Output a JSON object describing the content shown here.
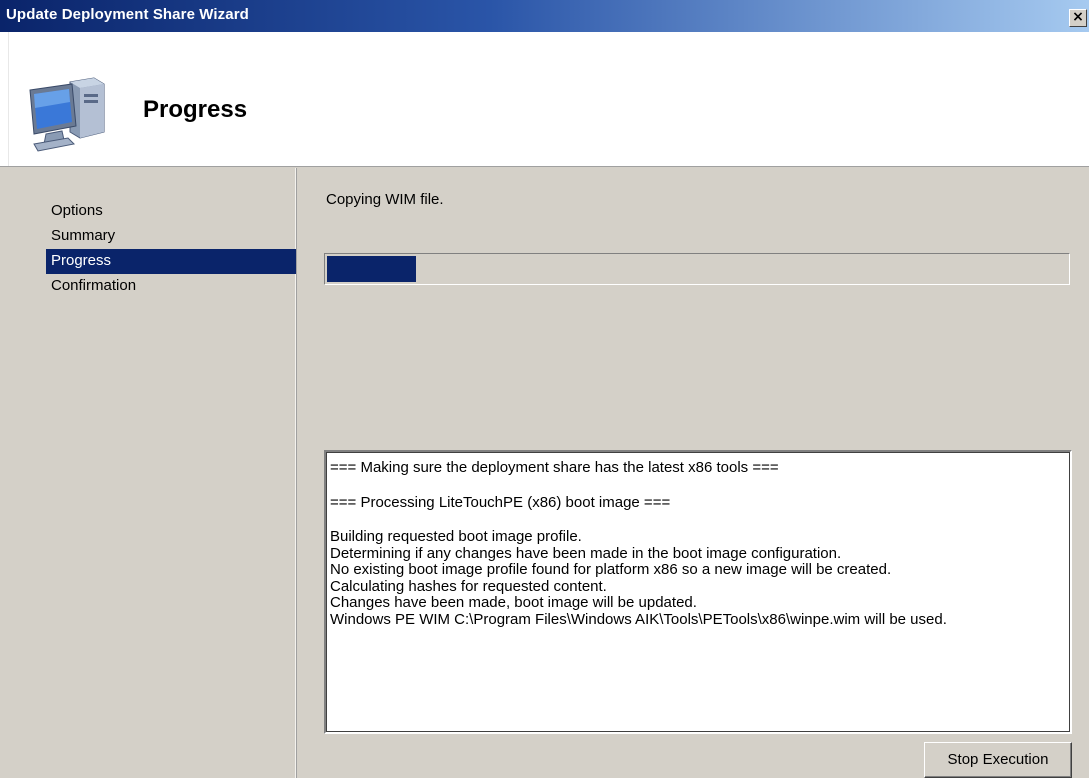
{
  "window": {
    "title": "Update Deployment Share Wizard",
    "close_label": "×",
    "icon_name": "computer-icon",
    "colors": {
      "titlebar": "#0a246a",
      "accent": "#0a246a",
      "background": "#d4d0c8"
    }
  },
  "header": {
    "title": "Progress"
  },
  "sidebar": {
    "items": [
      {
        "label": "Options",
        "active": false
      },
      {
        "label": "Summary",
        "active": false
      },
      {
        "label": "Progress",
        "active": true
      },
      {
        "label": "Confirmation",
        "active": false
      }
    ]
  },
  "main": {
    "status": "Copying WIM file.",
    "progress_fraction": 0.12,
    "log": [
      "=== Making sure the deployment share has the latest x86 tools ===",
      "",
      "=== Processing LiteTouchPE (x86) boot image ===",
      "",
      "Building requested boot image profile.",
      "Determining if any changes have been made in the boot image configuration.",
      "No existing boot image profile found for platform x86 so a new image will be created.",
      "Calculating hashes for requested content.",
      "Changes have been made, boot image will be updated.",
      "Windows PE WIM C:\\Program Files\\Windows AIK\\Tools\\PETools\\x86\\winpe.wim will be used."
    ],
    "stop_button_label": "Stop Execution"
  }
}
